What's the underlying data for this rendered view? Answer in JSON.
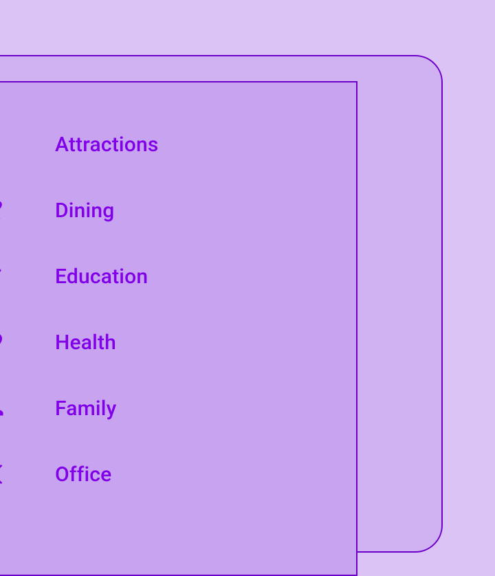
{
  "colors": {
    "bg": "#DBC4F5",
    "panel_outer": "#D0B1F2",
    "panel_inner": "#C7A3F0",
    "border": "#6C00C8",
    "accent": "#8100E7"
  },
  "menu": {
    "items": [
      {
        "icon": "film-icon",
        "label": "Attractions"
      },
      {
        "icon": "dining-icon",
        "label": "Dining"
      },
      {
        "icon": "pencil-icon",
        "label": "Education"
      },
      {
        "icon": "heart-icon",
        "label": "Health"
      },
      {
        "icon": "family-icon",
        "label": "Family"
      },
      {
        "icon": "scissors-icon",
        "label": "Office"
      }
    ]
  }
}
